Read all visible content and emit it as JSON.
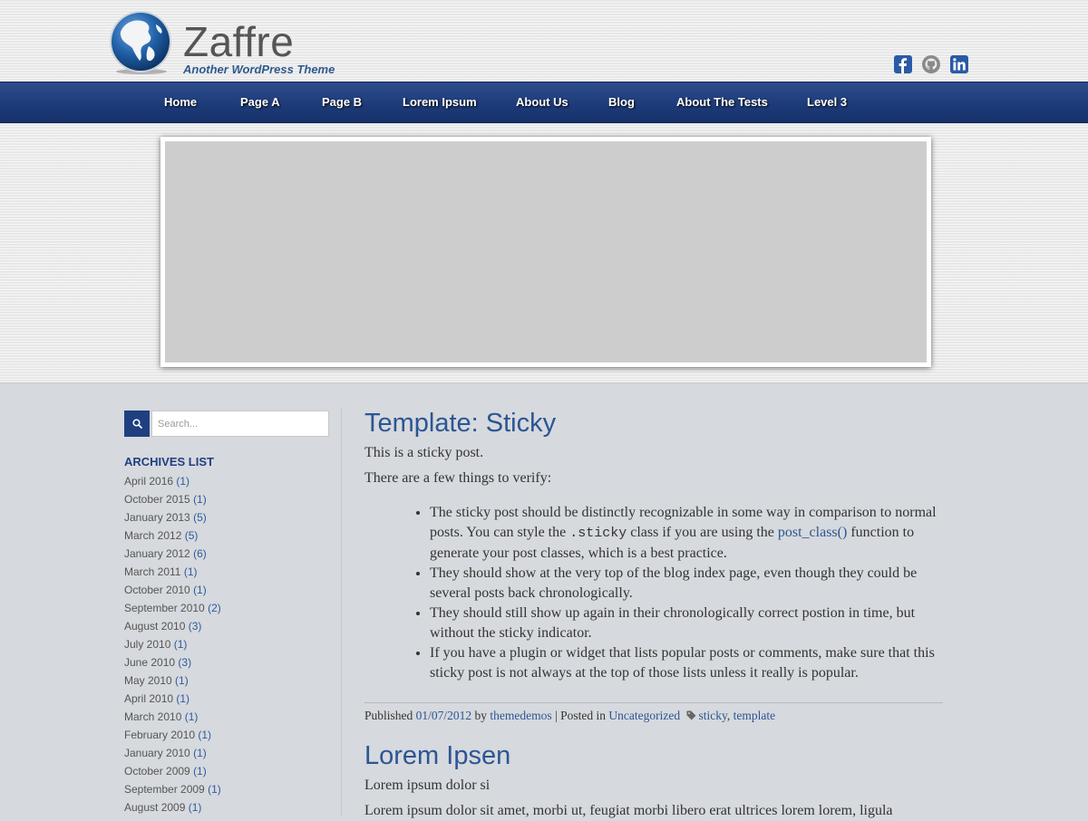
{
  "site": {
    "title": "Zaffre",
    "description": "Another WordPress Theme"
  },
  "social": {
    "icons": [
      "facebook-icon",
      "github-icon",
      "linkedin-icon"
    ]
  },
  "nav": {
    "items": [
      {
        "label": "Home"
      },
      {
        "label": "Page A"
      },
      {
        "label": "Page B"
      },
      {
        "label": "Lorem Ipsum"
      },
      {
        "label": "About Us"
      },
      {
        "label": "Blog"
      },
      {
        "label": "About The Tests"
      },
      {
        "label": "Level 3"
      }
    ]
  },
  "sidebar": {
    "search": {
      "placeholder": "Search..."
    },
    "archives_title": "ARCHIVES LIST",
    "archives": [
      {
        "label": "April 2016",
        "count": "(1)"
      },
      {
        "label": "October 2015",
        "count": "(1)"
      },
      {
        "label": "January 2013",
        "count": "(5)"
      },
      {
        "label": "March 2012",
        "count": "(5)"
      },
      {
        "label": "January 2012",
        "count": "(6)"
      },
      {
        "label": "March 2011",
        "count": "(1)"
      },
      {
        "label": "October 2010",
        "count": "(1)"
      },
      {
        "label": "September 2010",
        "count": "(2)"
      },
      {
        "label": "August 2010",
        "count": "(3)"
      },
      {
        "label": "July 2010",
        "count": "(1)"
      },
      {
        "label": "June 2010",
        "count": "(3)"
      },
      {
        "label": "May 2010",
        "count": "(1)"
      },
      {
        "label": "April 2010",
        "count": "(1)"
      },
      {
        "label": "March 2010",
        "count": "(1)"
      },
      {
        "label": "February 2010",
        "count": "(1)"
      },
      {
        "label": "January 2010",
        "count": "(1)"
      },
      {
        "label": "October 2009",
        "count": "(1)"
      },
      {
        "label": "September 2009",
        "count": "(1)"
      },
      {
        "label": "August 2009",
        "count": "(1)"
      }
    ]
  },
  "posts": [
    {
      "title": "Template: Sticky",
      "p1": "This is a sticky post.",
      "p2": "There are a few things to verify:",
      "bullets": {
        "b1_a": "The sticky post should be distinctly recognizable in some way in comparison to normal posts. You can style the ",
        "b1_code": ".sticky",
        "b1_b": " class if you are using the ",
        "b1_link": "post_class()",
        "b1_c": " function to generate your post classes, which is a best practice.",
        "b2": "They should show at the very top of the blog index page, even though they could be several posts back chronologically.",
        "b3": "They should still show up again in their chronologically correct postion in time, but without the sticky indicator.",
        "b4": "If you have a plugin or widget that lists popular posts or comments, make sure that this sticky post is not always at the top of those lists unless it really is popular."
      },
      "meta": {
        "published": "Published",
        "date": "01/07/2012",
        "by": "by",
        "author": "themedemos",
        "posted_in": "| Posted in",
        "category": "Uncategorized",
        "tag1": "sticky",
        "sep": ",",
        "tag2": "template"
      }
    },
    {
      "title": "Lorem Ipsen",
      "p1": "Lorem ipsum dolor si",
      "p2": "Lorem ipsum dolor sit amet, morbi ut, feugiat morbi libero erat ultrices lorem lorem, ligula"
    }
  ],
  "colors": {
    "accent": "#2c5594",
    "nav_bg": "#1d3a78",
    "page_bg": "#d6d9dd"
  }
}
